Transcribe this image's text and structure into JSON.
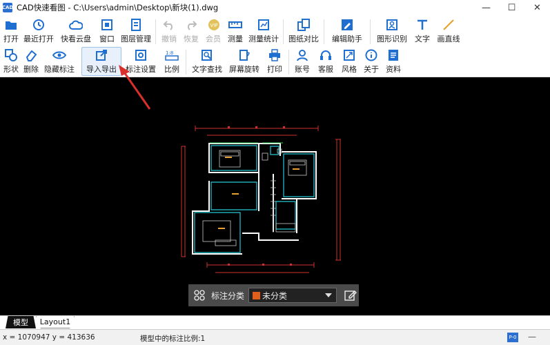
{
  "window": {
    "icon_text": "CAD",
    "title": "CAD快速看图 - C:\\Users\\admin\\Desktop\\新块(1).dwg",
    "minimize": "—",
    "maximize": "☐",
    "close": "✕"
  },
  "toolbar": {
    "row1": [
      {
        "label": "打开",
        "icon": "folder-icon"
      },
      {
        "label": "最近打开",
        "icon": "recent-icon"
      },
      {
        "label": "快看云盘",
        "icon": "cloud-icon"
      },
      {
        "label": "窗口",
        "icon": "window-icon"
      },
      {
        "label": "图层管理",
        "icon": "layers-icon"
      },
      {
        "label": "撤销",
        "icon": "undo-icon",
        "disabled": true
      },
      {
        "label": "恢复",
        "icon": "redo-icon",
        "disabled": true
      },
      {
        "label": "会员",
        "icon": "vip-icon",
        "disabled": true
      },
      {
        "label": "测量",
        "icon": "measure-icon"
      },
      {
        "label": "测量统计",
        "icon": "measure-stats-icon"
      },
      {
        "label": "图纸对比",
        "icon": "compare-icon"
      },
      {
        "label": "编辑助手",
        "icon": "edit-assistant-icon"
      },
      {
        "label": "图形识别",
        "icon": "shape-recognize-icon"
      },
      {
        "label": "文字",
        "icon": "text-icon"
      },
      {
        "label": "画直线",
        "icon": "line-icon"
      }
    ],
    "row2": [
      {
        "label": "形状",
        "icon": "shape-icon"
      },
      {
        "label": "删除",
        "icon": "eraser-icon"
      },
      {
        "label": "隐藏标注",
        "icon": "eye-icon"
      },
      {
        "label": "导入导出",
        "icon": "import-export-icon",
        "highlight": true
      },
      {
        "label": "标注设置",
        "icon": "settings-icon"
      },
      {
        "label": "比例",
        "icon": "scale-icon"
      },
      {
        "label": "文字查找",
        "icon": "text-search-icon"
      },
      {
        "label": "屏幕旋转",
        "icon": "rotate-icon"
      },
      {
        "label": "打印",
        "icon": "print-icon"
      },
      {
        "label": "账号",
        "icon": "account-icon"
      },
      {
        "label": "客服",
        "icon": "headset-icon"
      },
      {
        "label": "风格",
        "icon": "style-icon"
      },
      {
        "label": "关于",
        "icon": "info-icon"
      },
      {
        "label": "资料",
        "icon": "docs-icon"
      }
    ]
  },
  "floatbar": {
    "label": "标注分类",
    "selected": "未分类",
    "swatch_color": "#e0601b"
  },
  "tabs": {
    "active": "模型",
    "inactive": "Layout1"
  },
  "status": {
    "coords": "x = 1070947  y = 413636",
    "scale": "模型中的标注比例:1",
    "badge": "P-0",
    "minus": "—"
  },
  "colors": {
    "accent": "#2a6fd1",
    "canvas_bg": "#000000",
    "annotation_arrow": "#d9302c"
  }
}
